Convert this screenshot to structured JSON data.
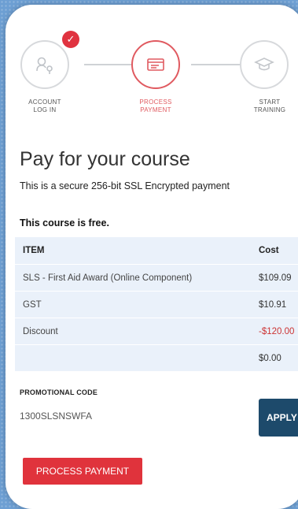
{
  "steps": [
    {
      "label_line1": "ACCOUNT",
      "label_line2": "LOG IN",
      "state": "complete",
      "icon": "user-key-icon"
    },
    {
      "label_line1": "PROCESS",
      "label_line2": "PAYMENT",
      "state": "active",
      "icon": "payment-card-icon"
    },
    {
      "label_line1": "START",
      "label_line2": "TRAINING",
      "state": "pending",
      "icon": "graduation-cap-icon"
    }
  ],
  "check_mark": "✓",
  "page": {
    "title": "Pay for your course",
    "subtitle": "This is a secure 256-bit SSL Encrypted payment",
    "free_note": "This course is free."
  },
  "table": {
    "headers": {
      "item": "ITEM",
      "cost": "Cost"
    },
    "rows": [
      {
        "item": "SLS - First Aid Award (Online Component)",
        "cost": "$109.09"
      },
      {
        "item": "GST",
        "cost": "$10.91"
      },
      {
        "item": "Discount",
        "cost": "-$120.00"
      },
      {
        "item": "",
        "cost": "$0.00"
      }
    ]
  },
  "promo": {
    "label": "PROMOTIONAL CODE",
    "value": "1300SLSNSWFA",
    "apply_label": "APPLY"
  },
  "actions": {
    "process_payment_label": "PROCESS PAYMENT"
  },
  "colors": {
    "accent": "#e0333c",
    "apply": "#1d4a6b",
    "table_bg": "#eaf1fa",
    "background": "#6d9fd3"
  }
}
